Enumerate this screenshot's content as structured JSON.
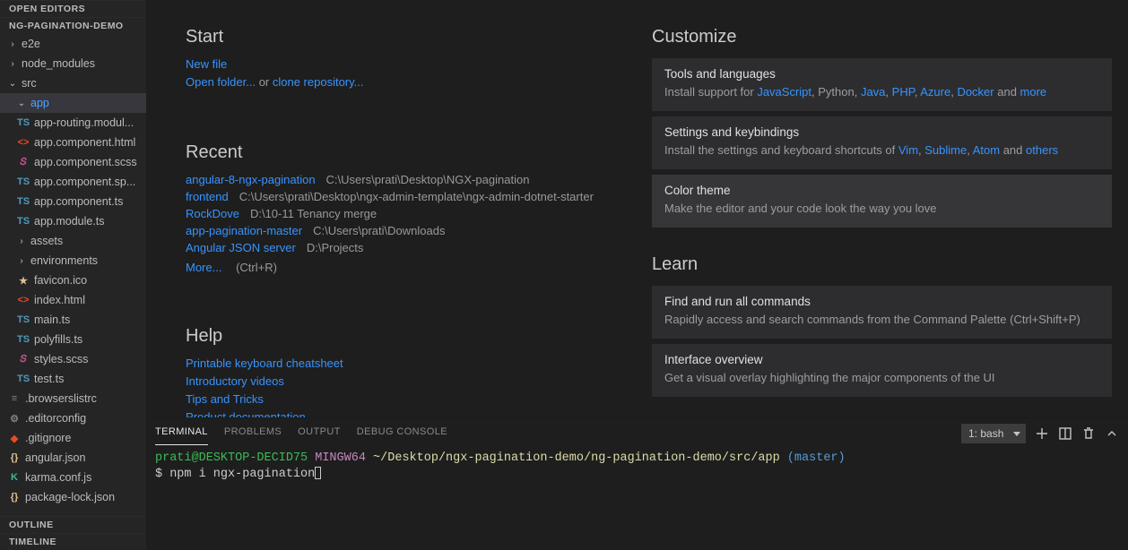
{
  "sidebar": {
    "open_editors_label": "OPEN EDITORS",
    "project_label": "NG-PAGINATION-DEMO",
    "outline_label": "OUTLINE",
    "timeline_label": "TIMELINE",
    "tree": {
      "e2e": "e2e",
      "node_modules": "node_modules",
      "src": "src",
      "app": "app",
      "files": {
        "app_routing": "app-routing.modul...",
        "app_comp_html": "app.component.html",
        "app_comp_scss": "app.component.scss",
        "app_comp_spec": "app.component.sp...",
        "app_comp_ts": "app.component.ts",
        "app_module": "app.module.ts",
        "assets": "assets",
        "environments": "environments",
        "favicon": "favicon.ico",
        "index": "index.html",
        "main": "main.ts",
        "polyfills": "polyfills.ts",
        "styles": "styles.scss",
        "test": "test.ts",
        "browserslist": ".browserslistrc",
        "editorconfig": ".editorconfig",
        "gitignore": ".gitignore",
        "angular_json": "angular.json",
        "karma": "karma.conf.js",
        "pkg_lock": "package-lock.json"
      }
    }
  },
  "welcome": {
    "start_h": "Start",
    "start": {
      "new_file": "New file",
      "open_folder": "Open folder...",
      "or": " or ",
      "clone_repo": "clone repository..."
    },
    "recent_h": "Recent",
    "recent": [
      {
        "name": "angular-8-ngx-pagination",
        "path": "C:\\Users\\prati\\Desktop\\NGX-pagination"
      },
      {
        "name": "frontend",
        "path": "C:\\Users\\prati\\Desktop\\ngx-admin-template\\ngx-admin-dotnet-starter"
      },
      {
        "name": "RockDove",
        "path": "D:\\10-11 Tenancy merge"
      },
      {
        "name": "app-pagination-master",
        "path": "C:\\Users\\prati\\Downloads"
      },
      {
        "name": "Angular JSON server",
        "path": "D:\\Projects"
      }
    ],
    "more": "More...",
    "more_key": "(Ctrl+R)",
    "help_h": "Help",
    "help": {
      "cheatsheet": "Printable keyboard cheatsheet",
      "videos": "Introductory videos",
      "tips": "Tips and Tricks",
      "docs": "Product documentation"
    }
  },
  "customize": {
    "h": "Customize",
    "tools": {
      "title": "Tools and languages",
      "prefix": "Install support for ",
      "js": "JavaScript",
      "py": ", Python, ",
      "java": "Java",
      "c1": ", ",
      "php": "PHP",
      "c2": ", ",
      "azure": "Azure",
      "c3": ", ",
      "docker": "Docker",
      "and": " and ",
      "more": "more"
    },
    "settings": {
      "title": "Settings and keybindings",
      "prefix": "Install the settings and keyboard shortcuts of ",
      "vim": "Vim",
      "c1": ", ",
      "sublime": "Sublime",
      "c2": ", ",
      "atom": "Atom",
      "and": " and ",
      "others": "others"
    },
    "theme": {
      "title": "Color theme",
      "body": "Make the editor and your code look the way you love"
    }
  },
  "learn": {
    "h": "Learn",
    "cmd": {
      "title": "Find and run all commands",
      "body": "Rapidly access and search commands from the Command Palette (Ctrl+Shift+P)"
    },
    "ui": {
      "title": "Interface overview",
      "body": "Get a visual overlay highlighting the major components of the UI"
    }
  },
  "panel": {
    "tabs": {
      "terminal": "TERMINAL",
      "problems": "PROBLEMS",
      "output": "OUTPUT",
      "debug": "DEBUG CONSOLE"
    },
    "select": "1: bash",
    "term": {
      "user": "prati@DESKTOP-DECID75 ",
      "sys": "MINGW64 ",
      "path": "~/Desktop/ngx-pagination-demo/ng-pagination-demo/src/app ",
      "branch": "(master)",
      "line2": "$ npm i ngx-pagination"
    }
  }
}
